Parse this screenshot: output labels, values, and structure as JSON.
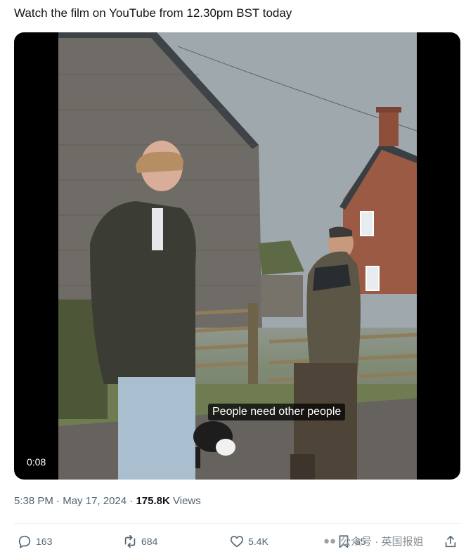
{
  "tweet": {
    "text": "Watch the film on YouTube from 12.30pm BST today"
  },
  "video": {
    "subtitle": "People need other people",
    "elapsed": "0:08"
  },
  "meta": {
    "time": "5:38 PM",
    "separator1": " · ",
    "date": "May 17, 2024",
    "separator2": " · ",
    "views_count": "175.8K",
    "views_label": " Views"
  },
  "actions": {
    "replies": "163",
    "reposts": "684",
    "likes": "5.4K",
    "bookmarks": "65"
  },
  "watermark": {
    "text": "公众号 · 英国报姐"
  },
  "colors": {
    "text": "#0f1419",
    "secondary": "#536471",
    "divider": "#eff3f4"
  }
}
